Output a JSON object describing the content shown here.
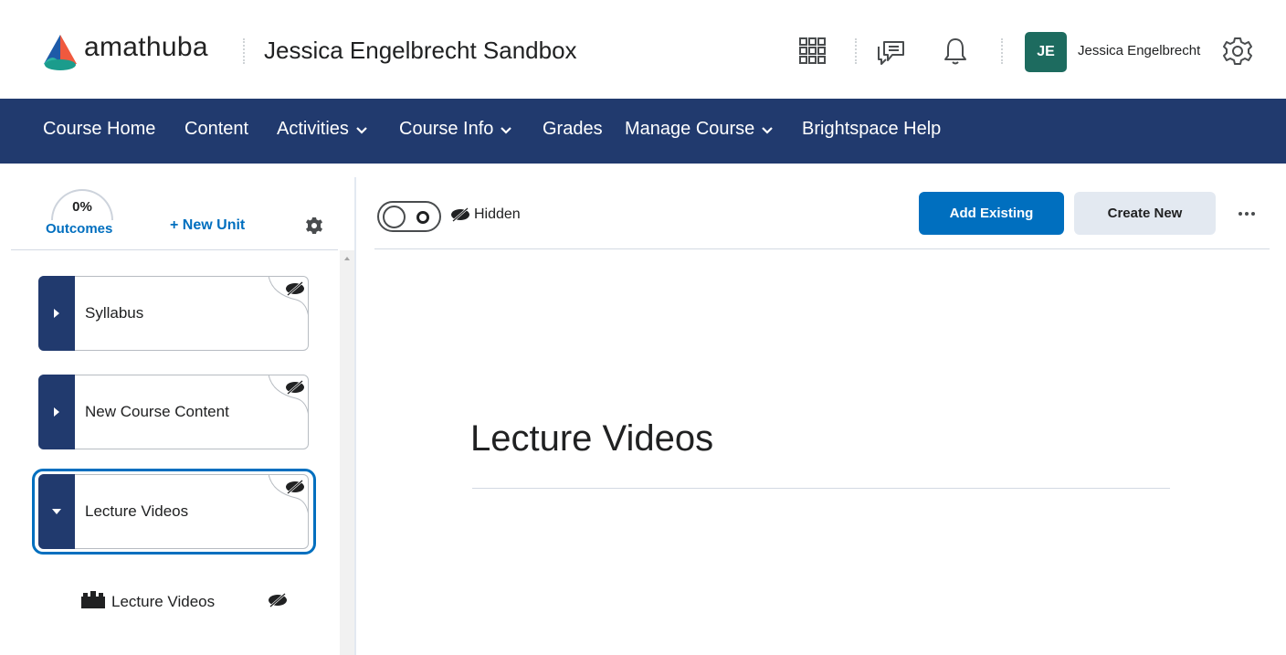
{
  "header": {
    "brand": "amathuba",
    "course_title": "Jessica Engelbrecht Sandbox",
    "user_initials": "JE",
    "user_name": "Jessica Engelbrecht",
    "icons": [
      "grid-icon",
      "chat-icon",
      "bell-icon",
      "settings-gear-icon"
    ]
  },
  "nav": {
    "items": [
      {
        "label": "Course Home",
        "has_dropdown": false
      },
      {
        "label": "Content",
        "has_dropdown": false
      },
      {
        "label": "Activities",
        "has_dropdown": true
      },
      {
        "label": "Course Info",
        "has_dropdown": true
      },
      {
        "label": "Grades",
        "has_dropdown": false
      },
      {
        "label": "Manage Course",
        "has_dropdown": true
      },
      {
        "label": "Brightspace Help",
        "has_dropdown": false
      }
    ]
  },
  "sidebar": {
    "outcomes_percent": "0%",
    "outcomes_label": "Outcomes",
    "new_unit_label": "+ New Unit",
    "units": [
      {
        "label": "Syllabus",
        "expanded": false,
        "hidden": true
      },
      {
        "label": "New Course Content",
        "expanded": false,
        "hidden": true
      },
      {
        "label": "Lecture Videos",
        "expanded": true,
        "hidden": true,
        "selected": true
      }
    ],
    "sub_items": [
      {
        "label": "Lecture Videos",
        "icon": "lesson-blocks-icon",
        "hidden": true
      }
    ]
  },
  "main": {
    "visibility_label": "Hidden",
    "add_existing_label": "Add Existing",
    "create_new_label": "Create New",
    "title": "Lecture Videos"
  },
  "colors": {
    "nav_bg": "#213a6e",
    "primary": "#006fbf",
    "avatar_bg": "#1d6b5f",
    "secondary_btn_bg": "#e3e9f1"
  }
}
